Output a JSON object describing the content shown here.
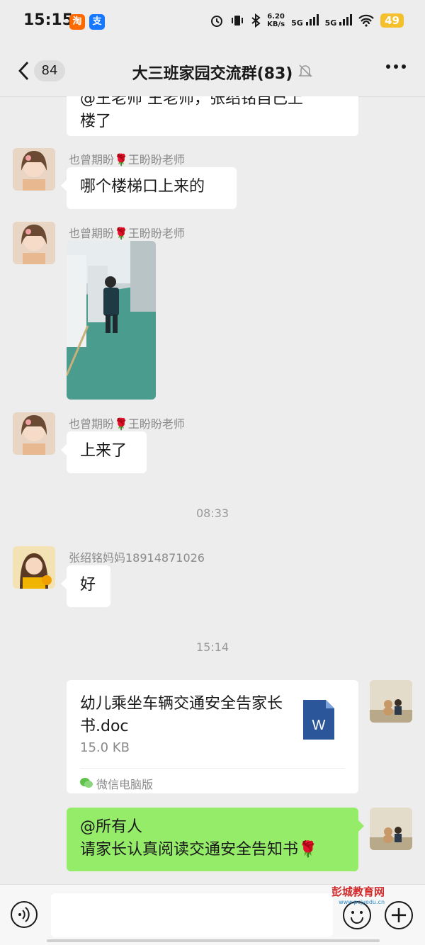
{
  "status_bar": {
    "time": "15:15",
    "app1": "淘",
    "app2": "支",
    "speed_value": "6.20",
    "speed_unit": "KB/s",
    "net1": "5G",
    "net2": "5G",
    "battery": "49"
  },
  "nav": {
    "unread_count": "84",
    "title": "大三班家园交流群(83)"
  },
  "messages": [
    {
      "type": "text",
      "side": "left",
      "text_line1": "@王老师  王老师，张绍铭自己上",
      "text_line2": "楼了"
    },
    {
      "type": "text",
      "side": "left",
      "sender": "也曾期盼🌹王盼盼老师",
      "text": "哪个楼梯口上来的"
    },
    {
      "type": "image",
      "side": "left",
      "sender": "也曾期盼🌹王盼盼老师"
    },
    {
      "type": "text",
      "side": "left",
      "sender": "也曾期盼🌹王盼盼老师",
      "text": "上来了"
    },
    {
      "type": "time",
      "text": "08:33"
    },
    {
      "type": "text",
      "side": "left",
      "sender": "张绍铭妈妈18914871026",
      "text": "好"
    },
    {
      "type": "time",
      "text": "15:14"
    },
    {
      "type": "file",
      "side": "right",
      "file_name": "幼儿乘坐车辆交通安全告家长书.doc",
      "file_size": "15.0 KB",
      "source": "微信电脑版",
      "icon_letter": "W"
    },
    {
      "type": "text",
      "side": "right",
      "text_line1": "@所有人",
      "text_line2": "请家长认真阅读交通安全告知书🌹"
    }
  ],
  "input": {
    "placeholder": ""
  },
  "watermark": {
    "name": "彭城教育网",
    "url": "www.pcjyedu.cn"
  },
  "colors": {
    "bg": "#ededed",
    "green_bubble": "#95ec69",
    "word_icon": "#2b579a"
  },
  "icons": [
    "back-icon",
    "mute-bell-icon",
    "more-icon",
    "voice-icon",
    "emoji-icon",
    "plus-icon",
    "word-doc-icon",
    "wechat-pc-icon"
  ]
}
